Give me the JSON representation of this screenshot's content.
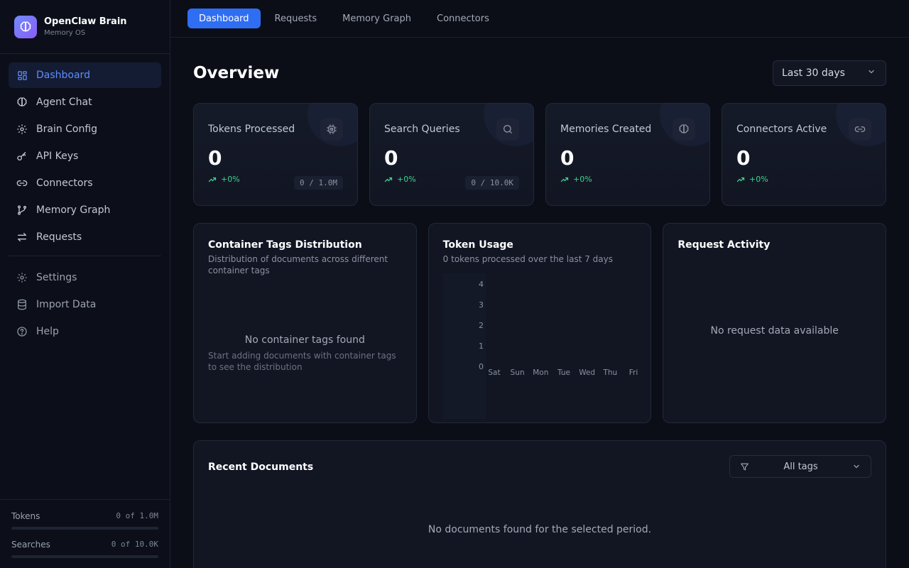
{
  "brand": {
    "title": "OpenClaw Brain",
    "subtitle": "Memory OS"
  },
  "sidebar": {
    "items": [
      {
        "label": "Dashboard",
        "icon": "dashboard-icon",
        "active": true
      },
      {
        "label": "Agent Chat",
        "icon": "brain-icon"
      },
      {
        "label": "Brain Config",
        "icon": "gear-icon"
      },
      {
        "label": "API Keys",
        "icon": "key-icon"
      },
      {
        "label": "Connectors",
        "icon": "link-icon"
      },
      {
        "label": "Memory Graph",
        "icon": "graph-icon"
      },
      {
        "label": "Requests",
        "icon": "arrows-icon"
      }
    ],
    "secondary": [
      {
        "label": "Settings",
        "icon": "gear-icon"
      },
      {
        "label": "Import Data",
        "icon": "database-icon"
      },
      {
        "label": "Help",
        "icon": "help-icon"
      }
    ],
    "usage": [
      {
        "label": "Tokens",
        "value": "0 of 1.0M",
        "fraction": 0
      },
      {
        "label": "Searches",
        "value": "0 of 10.0K",
        "fraction": 0
      }
    ]
  },
  "topnav": {
    "tabs": [
      "Dashboard",
      "Requests",
      "Memory Graph",
      "Connectors"
    ],
    "active": 0
  },
  "page": {
    "title": "Overview",
    "range": "Last 30 days"
  },
  "stats": [
    {
      "label": "Tokens Processed",
      "value": "0",
      "delta": "+0%",
      "quota": "0 / 1.0M",
      "icon": "chip-icon"
    },
    {
      "label": "Search Queries",
      "value": "0",
      "delta": "+0%",
      "quota": "0 / 10.0K",
      "icon": "search-icon"
    },
    {
      "label": "Memories Created",
      "value": "0",
      "delta": "+0%",
      "quota": "",
      "icon": "brain-icon"
    },
    {
      "label": "Connectors Active",
      "value": "0",
      "delta": "+0%",
      "quota": "",
      "icon": "link-icon"
    }
  ],
  "panels": {
    "tags": {
      "title": "Container Tags Distribution",
      "subtitle": "Distribution of documents across different container tags",
      "empty_title": "No container tags found",
      "empty_sub": "Start adding documents with container tags to see the distribution"
    },
    "tokens": {
      "title": "Token Usage",
      "subtitle": "0 tokens processed over the last 7 days"
    },
    "requests": {
      "title": "Request Activity",
      "empty": "No request data available"
    }
  },
  "chart_data": {
    "type": "bar",
    "categories": [
      "Sat",
      "Sun",
      "Mon",
      "Tue",
      "Wed",
      "Thu",
      "Fri"
    ],
    "values": [
      0,
      0,
      0,
      0,
      0,
      0,
      0
    ],
    "yticks": [
      0,
      1,
      2,
      3,
      4
    ],
    "ylim": [
      0,
      4
    ],
    "title": "Token Usage",
    "xlabel": "",
    "ylabel": "",
    "grid": false
  },
  "docs": {
    "title": "Recent Documents",
    "filter": "All tags",
    "empty": "No documents found for the selected period."
  },
  "colors": {
    "accent": "#2f6ef2",
    "positive": "#3fd38b",
    "background": "#0b0e17"
  }
}
